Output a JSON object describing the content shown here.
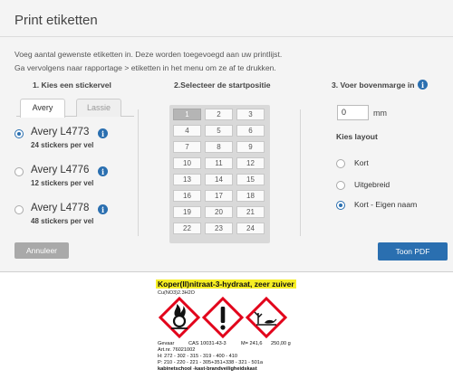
{
  "dialog": {
    "title": "Print etiketten",
    "intro_line1": "Voeg aantal gewenste etiketten in. Deze worden toegevoegd aan uw printlijst.",
    "intro_line2": "Ga vervolgens naar rapportage > etiketten in het menu om ze af te drukken."
  },
  "step1": {
    "heading": "1. Kies een stickervel",
    "tabs": [
      {
        "label": "Avery",
        "active": true
      },
      {
        "label": "Lassie",
        "active": false
      }
    ],
    "options": [
      {
        "name": "Avery L4773",
        "sub": "24 stickers per vel",
        "selected": true
      },
      {
        "name": "Avery L4776",
        "sub": "12 stickers per vel",
        "selected": false
      },
      {
        "name": "Avery L4778",
        "sub": "48 stickers per vel",
        "selected": false
      }
    ]
  },
  "step2": {
    "heading": "2.Selecteer de startpositie",
    "positions": [
      "1",
      "2",
      "3",
      "4",
      "5",
      "6",
      "7",
      "8",
      "9",
      "10",
      "11",
      "12",
      "13",
      "14",
      "15",
      "16",
      "17",
      "18",
      "19",
      "20",
      "21",
      "22",
      "23",
      "24"
    ],
    "selected_position": "1"
  },
  "step3": {
    "heading": "3. Voer bovenmarge in",
    "margin_value": "0",
    "margin_unit": "mm",
    "layout_heading": "Kies layout",
    "layouts": [
      {
        "label": "Kort",
        "selected": false
      },
      {
        "label": "Uitgebreid",
        "selected": false
      },
      {
        "label": "Kort - Eigen naam",
        "selected": true
      }
    ]
  },
  "buttons": {
    "cancel": "Annuleer",
    "pdf": "Toon PDF"
  },
  "colors": {
    "accent": "#2a6fb0",
    "highlight": "#f6ee24",
    "hazard_red": "#e2001a"
  },
  "preview_label": {
    "title": "Koper(II)nitraat-3-hydraat, zeer zuiver",
    "formula": "Cu(NO3)2.3H2O",
    "pictograms": [
      "oxidizing-flame-icon",
      "exclamation-mark-icon",
      "environment-icon"
    ],
    "signal_word": "Gevaar",
    "cas": "CAS 10031-43-3",
    "molar_mass": "M= 241,6",
    "quantity": "250,00 g",
    "article": "Art.nr. 76021002",
    "h_statements": "H: 272 - 302 - 315 - 319 - 400 - 410",
    "p_statements": "P: 210 - 220 - 221 - 305+351+338 - 321 - 501a",
    "location": "kabinetschool -kast-brandveiligheidskast"
  }
}
